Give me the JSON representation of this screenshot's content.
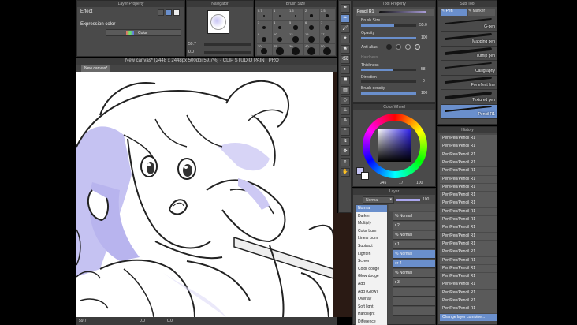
{
  "colors": {
    "accent": "#8f8cf0",
    "panel": "#4a4a4a",
    "panel_dark": "#3a3a3a",
    "selection": "#6a8fcc"
  },
  "layer_property": {
    "title": "Layer Property",
    "effect_label": "Effect",
    "expression_color_label": "Expression color",
    "color_value": "Color"
  },
  "navigator": {
    "title": "Navigator",
    "zoom": "59.7",
    "rotate": "0.0"
  },
  "brush_size": {
    "title": "Brush Size",
    "sizes": [
      "0.7",
      "1",
      "1.5",
      "2",
      "2.5",
      "3",
      "4",
      "5",
      "6",
      "7",
      "8",
      "10",
      "12",
      "15",
      "17",
      "20",
      "25",
      "30",
      "40",
      "50"
    ]
  },
  "document": {
    "window_title": "New canvas* (2448 x 2448px 500dpi 59.7%) - CLIP STUDIO PAINT PRO",
    "tab": "New canvas*",
    "status_zoom": "59.7",
    "status_a": "0.0",
    "status_b": "0.0"
  },
  "tool_property": {
    "title": "Tool Property",
    "tool_name": "Pencil R1",
    "brush_size_label": "Brush Size",
    "brush_size_value": "55.0",
    "opacity_label": "Opacity",
    "opacity_value": "100",
    "antialias_label": "Anti-alias",
    "hardness_label": "Hardness",
    "thickness_label": "Thickness",
    "thickness_value": "58",
    "direction_label": "Direction",
    "direction_value": "0",
    "density_label": "Brush density",
    "density_value": "100"
  },
  "color_wheel": {
    "title": "Color Wheel",
    "v1": "245",
    "v2": "17",
    "v3": "100"
  },
  "layer": {
    "title": "Layer",
    "blend_mode": "Normal",
    "opacity": "100",
    "blend_menu": [
      "Normal",
      "Darken",
      "Multiply",
      "Color burn",
      "Linear burn",
      "Subtract",
      "Lighten",
      "Screen",
      "Color dodge",
      "Glow dodge",
      "Add",
      "Add (Glow)",
      "Overlay",
      "Soft light",
      "Hard light",
      "Difference"
    ],
    "layers": [
      "% Normal",
      "r 2",
      "% Normal",
      "r 1",
      "% Normal",
      "er 4",
      "% Normal",
      "r 3",
      "",
      "",
      ""
    ]
  },
  "sub_tool": {
    "title": "Sub Tool",
    "tab_pen": "Pen",
    "tab_marker": "Marker",
    "pens": [
      "G-pen",
      "Mapping pen",
      "Turnip pen",
      "Calligraphy",
      "For effect line",
      "Textured pen",
      "Pencil R1"
    ]
  },
  "history": {
    "title": "History",
    "items": [
      "Pen/Pen/Pencil R1",
      "Pen/Pen/Pencil R1",
      "Pen/Pen/Pencil R1",
      "Pen/Pen/Pencil R1",
      "Pen/Pen/Pencil R1",
      "Pen/Pen/Pencil R1",
      "Pen/Pen/Pencil R1",
      "Pen/Pen/Pencil R1",
      "Pen/Pen/Pencil R1",
      "Pen/Pen/Pencil R1",
      "Pen/Pen/Pencil R1",
      "Pen/Pen/Pencil R1",
      "Pen/Pen/Pencil R1",
      "Pen/Pen/Pencil R1",
      "Pen/Pen/Pencil R1",
      "Pen/Pen/Pencil R1",
      "Pen/Pen/Pencil R1",
      "Pen/Pen/Pencil R1",
      "Pen/Pen/Pencil R1",
      "Pen/Pen/Pencil R1",
      "Pen/Pen/Pencil R1",
      "Pen/Pen/Pencil R1",
      "Change layer combine..."
    ]
  },
  "tools": [
    "pen-icon",
    "pencil-icon",
    "brush-icon",
    "airbrush-icon",
    "decoration-icon",
    "eraser-icon",
    "blend-icon",
    "fill-icon",
    "gradient-icon",
    "figure-icon",
    "ruler-icon",
    "text-icon",
    "balloon-icon",
    "correct-line-icon",
    "move-icon",
    "zoom-icon",
    "hand-icon"
  ]
}
